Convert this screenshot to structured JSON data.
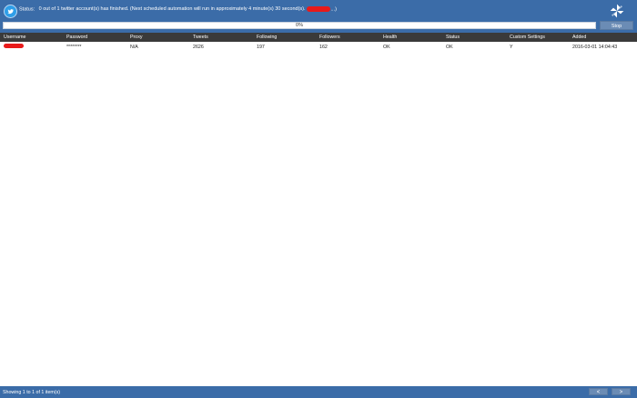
{
  "status": {
    "prefix": "Status:",
    "message": "0 out of 1 twitter account(s) has finished. (Next scheduled automation will run in approximately 4 minute(s) 30 second(s).",
    "suffix": "...)"
  },
  "progress": {
    "label": "0%",
    "value": 0
  },
  "stop_label": "Stop",
  "table": {
    "columns": [
      "Username",
      "Password",
      "Proxy",
      "Tweets",
      "Following",
      "Followers",
      "Health",
      "Status",
      "Custom Settings",
      "Added"
    ],
    "rows": [
      {
        "username": "",
        "password": "********",
        "proxy": "N/A",
        "tweets": "2626",
        "following": "197",
        "followers": "162",
        "health": "OK",
        "status": "OK",
        "custom_settings": "Y",
        "added": "2016-03-01 14:04:43"
      }
    ]
  },
  "footer": {
    "summary": "Showing 1 to 1 of 1 item(s)",
    "prev": "<",
    "next": ">"
  },
  "icons": {
    "app": "twitter-bird-icon",
    "brand": "pinwheel-logo-icon"
  },
  "colors": {
    "header": "#3b6ca8",
    "table_header": "#3a3a3a",
    "redaction": "#e81a1a"
  }
}
